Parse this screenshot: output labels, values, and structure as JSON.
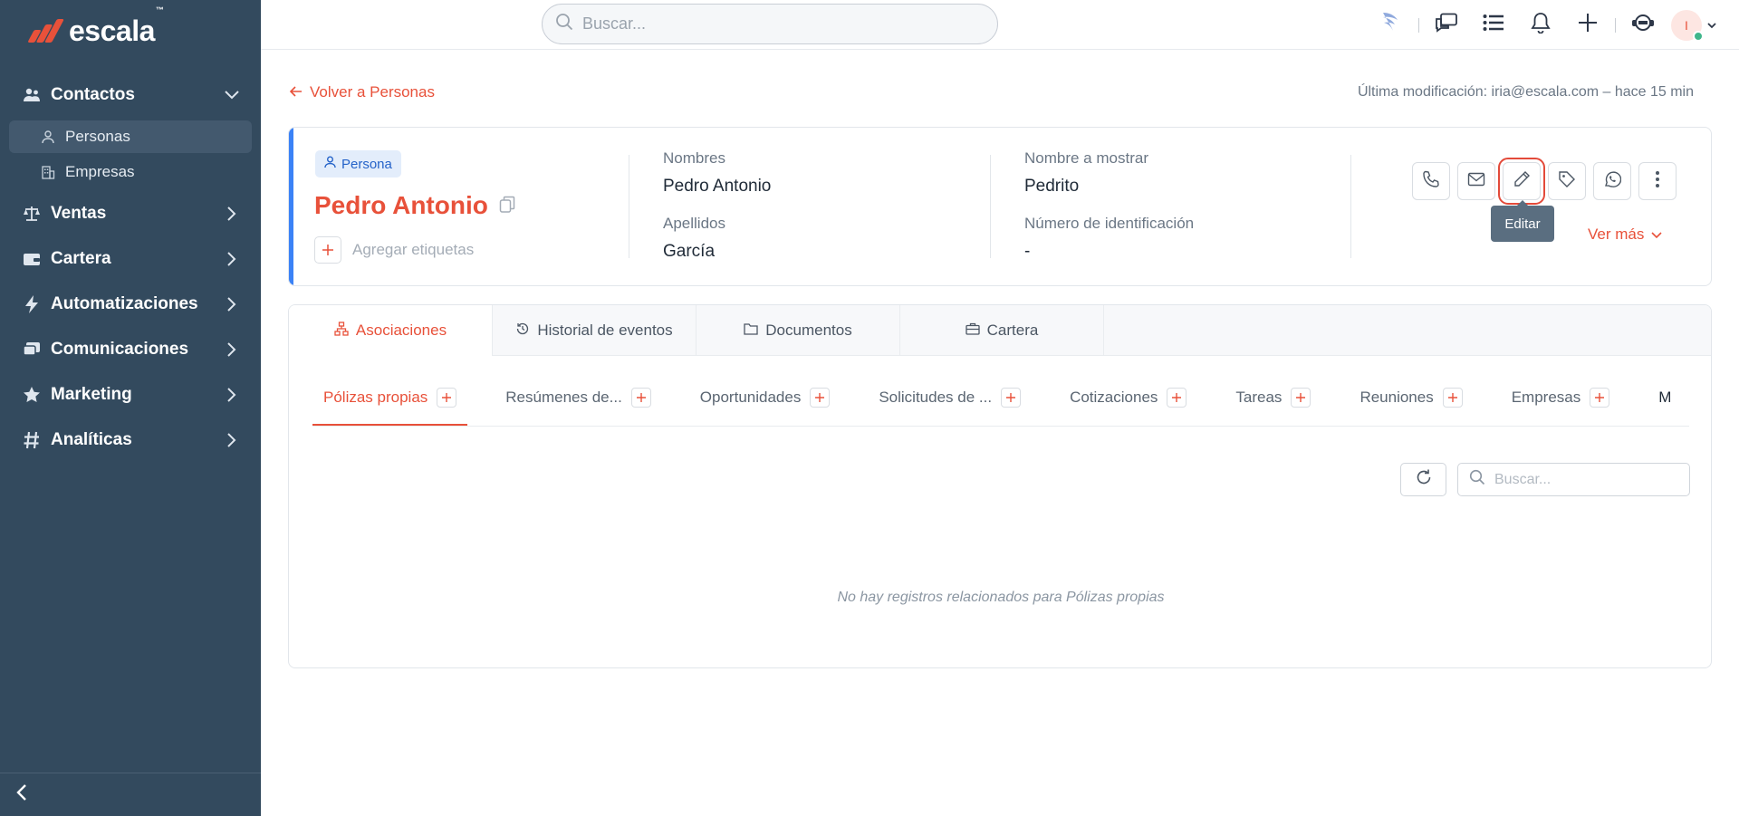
{
  "app": {
    "logo_text": "escala",
    "logo_tm": "™"
  },
  "sidebar": {
    "items": [
      {
        "label": "Contactos",
        "icon": "users-icon",
        "expanded": true
      },
      {
        "label": "Ventas",
        "icon": "scale-icon"
      },
      {
        "label": "Cartera",
        "icon": "wallet-icon"
      },
      {
        "label": "Automatizaciones",
        "icon": "bolt-icon"
      },
      {
        "label": "Comunicaciones",
        "icon": "chat-icon"
      },
      {
        "label": "Marketing",
        "icon": "star-icon"
      },
      {
        "label": "Analíticas",
        "icon": "hash-icon"
      }
    ],
    "subitems": [
      {
        "label": "Personas",
        "icon": "person-icon",
        "active": true
      },
      {
        "label": "Empresas",
        "icon": "building-icon"
      }
    ]
  },
  "topbar": {
    "search_placeholder": "Buscar...",
    "avatar_initial": "I"
  },
  "page": {
    "back_label": "Volver a Personas",
    "last_modified": "Última modificación: iria@escala.com – hace 15 min"
  },
  "record": {
    "badge": "Persona",
    "name": "Pedro Antonio",
    "add_tags": "Agregar etiquetas",
    "fields": {
      "nombres_label": "Nombres",
      "nombres_value": "Pedro Antonio",
      "apellidos_label": "Apellidos",
      "apellidos_value": "García",
      "mostrar_label": "Nombre a mostrar",
      "mostrar_value": "Pedrito",
      "id_label": "Número de identificación",
      "id_value": "-"
    },
    "tooltip": "Editar",
    "ver_mas": "Ver más"
  },
  "tabs": [
    {
      "label": "Asociaciones",
      "active": true
    },
    {
      "label": "Historial de eventos"
    },
    {
      "label": "Documentos"
    },
    {
      "label": "Cartera"
    }
  ],
  "subtabs": [
    {
      "label": "Pólizas propias",
      "active": true
    },
    {
      "label": "Resúmenes de..."
    },
    {
      "label": "Oportunidades"
    },
    {
      "label": "Solicitudes de ..."
    },
    {
      "label": "Cotizaciones"
    },
    {
      "label": "Tareas"
    },
    {
      "label": "Reuniones"
    },
    {
      "label": "Empresas"
    },
    {
      "label": "M"
    }
  ],
  "panel": {
    "search_placeholder": "Buscar...",
    "empty_message": "No hay registros relacionados para Pólizas propias"
  },
  "colors": {
    "sidebar_bg": "#334a5e",
    "accent": "#e8513a",
    "blue_accent": "#3b82f6"
  }
}
